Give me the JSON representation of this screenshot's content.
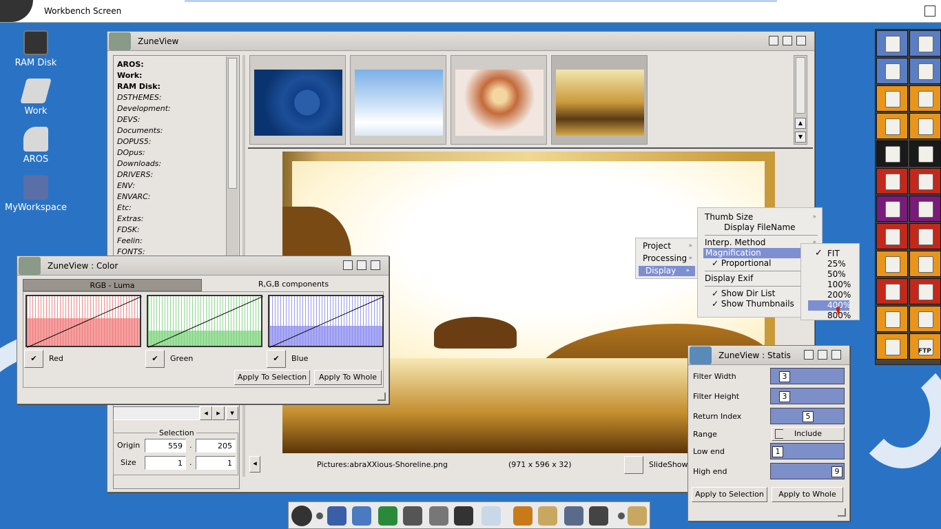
{
  "screen": {
    "title": "Workbench Screen"
  },
  "desktop_icons": [
    {
      "label": "RAM Disk"
    },
    {
      "label": "Work"
    },
    {
      "label": "AROS"
    },
    {
      "label": "MyWorkspace"
    }
  ],
  "main_window": {
    "title": "ZuneView",
    "dir_list": [
      "AROS:",
      "Work:",
      "RAM Disk:",
      "DSTHEMES:",
      "Development:",
      "DEVS:",
      "Documents:",
      "DOPUS5:",
      "DOpus:",
      "Downloads:",
      "DRIVERS:",
      "ENV:",
      "ENVARC:",
      "Etc:",
      "Extras:",
      "FDSK:",
      "Feelin:",
      "FONTS:"
    ],
    "selection": {
      "label": "Selection",
      "origin_label": "Origin",
      "size_label": "Size",
      "origin_x": "559",
      "origin_y": "205",
      "size_w": "1",
      "size_h": "1",
      "sep": "."
    },
    "status": {
      "path": "Pictures:abraXXious-Shoreline.png",
      "dims": "(971 x 596 x 32)",
      "slideshow_label": "SlideShow"
    }
  },
  "color_window": {
    "title": "ZuneView : Color",
    "tabs": [
      "RGB - Luma",
      "R,G,B components"
    ],
    "channels": [
      "Red",
      "Green",
      "Blue"
    ],
    "apply_selection": "Apply To Selection",
    "apply_whole": "Apply To Whole",
    "check_mark": "✔"
  },
  "context_menu": {
    "main": [
      "Project",
      "Processing",
      "Display"
    ],
    "display_sub": {
      "thumb_size": "Thumb Size",
      "display_filename": "Display FileName",
      "interp_method": "Interp. Method",
      "magnification": "Magnification",
      "proportional": "Proportional",
      "display_exif": "Display Exif",
      "show_dir_list": "Show Dir List",
      "show_thumbnails": "Show Thumbnails"
    },
    "magnification_options": [
      "FIT",
      "25%",
      "50%",
      "100%",
      "200%",
      "400%",
      "800%"
    ],
    "check": "✓"
  },
  "statis_window": {
    "title": "ZuneView : Statis",
    "fields": [
      {
        "label": "Filter Width",
        "value": "3"
      },
      {
        "label": "Filter Height",
        "value": "3"
      },
      {
        "label": "Return Index",
        "value": "5"
      },
      {
        "label": "Range",
        "value": "Include"
      },
      {
        "label": "Low end",
        "value": "1"
      },
      {
        "label": "High end",
        "value": "9"
      }
    ],
    "apply_selection": "Apply to Selection",
    "apply_whole": "Apply to Whole"
  },
  "right_dock": {
    "ftp_label": "FTP"
  },
  "colors": {
    "desktop": "#2a73c4",
    "highlight": "#7d8fd0",
    "window": "#e7e4e0"
  }
}
